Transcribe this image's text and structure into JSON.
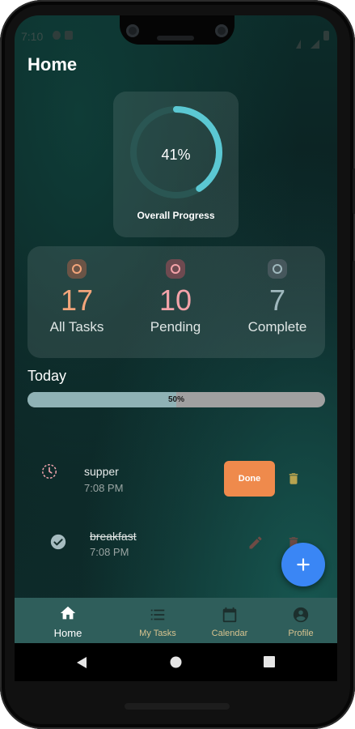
{
  "status_bar": {
    "time": "7:10"
  },
  "page": {
    "title": "Home"
  },
  "progress": {
    "percent_label": "41%",
    "fraction": 0.41,
    "caption": "Overall Progress"
  },
  "stats": [
    {
      "value": "17",
      "label": "All Tasks",
      "color": "#f2a57b"
    },
    {
      "value": "10",
      "label": "Pending",
      "color": "#f4a3a9"
    },
    {
      "value": "7",
      "label": "Complete",
      "color": "#9fb8bd"
    }
  ],
  "today": {
    "title": "Today",
    "progress_label": "50%",
    "fraction": 0.5
  },
  "tasks": [
    {
      "name": "supper",
      "time": "7:08 PM",
      "status": "pending",
      "action_label": "Done"
    },
    {
      "name": "breakfast",
      "time": "7:08 PM",
      "status": "completed"
    }
  ],
  "nav": [
    {
      "label": "Home",
      "icon": "home-icon",
      "active": true
    },
    {
      "label": "My Tasks",
      "icon": "list-icon",
      "active": false
    },
    {
      "label": "Calendar",
      "icon": "calendar-icon",
      "active": false
    },
    {
      "label": "Profile",
      "icon": "account-circle-icon",
      "active": false
    }
  ],
  "colors": {
    "accent": "#5bc8d3",
    "done_button": "#ef8a4c",
    "fab": "#3a86f5",
    "nav_bg": "#2f5e5b",
    "nav_inactive": "#d7c38f"
  }
}
